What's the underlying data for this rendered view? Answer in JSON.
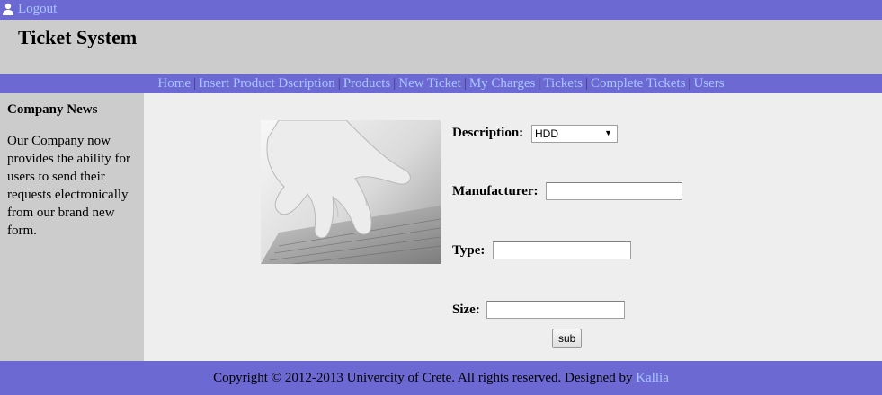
{
  "topbar": {
    "logout_label": "Logout",
    "icon": "user-icon"
  },
  "header": {
    "title": "Ticket System"
  },
  "nav": {
    "items": [
      {
        "label": "Home"
      },
      {
        "label": "Insert Product Dscription"
      },
      {
        "label": "Products"
      },
      {
        "label": "New Ticket"
      },
      {
        "label": "My Charges"
      },
      {
        "label": "Tickets"
      },
      {
        "label": "Complete Tickets"
      },
      {
        "label": "Users"
      }
    ],
    "separator": "|"
  },
  "sidebar": {
    "title": "Company News",
    "text": "Our Company now provides the ability for users to send their requests electronically from our brand new form."
  },
  "form": {
    "description_label": "Description:",
    "description_value": "HDD",
    "manufacturer_label": "Manufacturer:",
    "manufacturer_value": "",
    "type_label": "Type:",
    "type_value": "",
    "size_label": "Size:",
    "size_value": "",
    "submit_label": "sub"
  },
  "footer": {
    "text": "Copyright © 2012-2013 Univercity of Crete. All rights reserved. Designed by ",
    "link_label": "Kallia"
  },
  "colors": {
    "bar": "#6c69d2",
    "link": "#a8c6ff",
    "panel": "#cccccc",
    "content": "#eeeeee"
  }
}
